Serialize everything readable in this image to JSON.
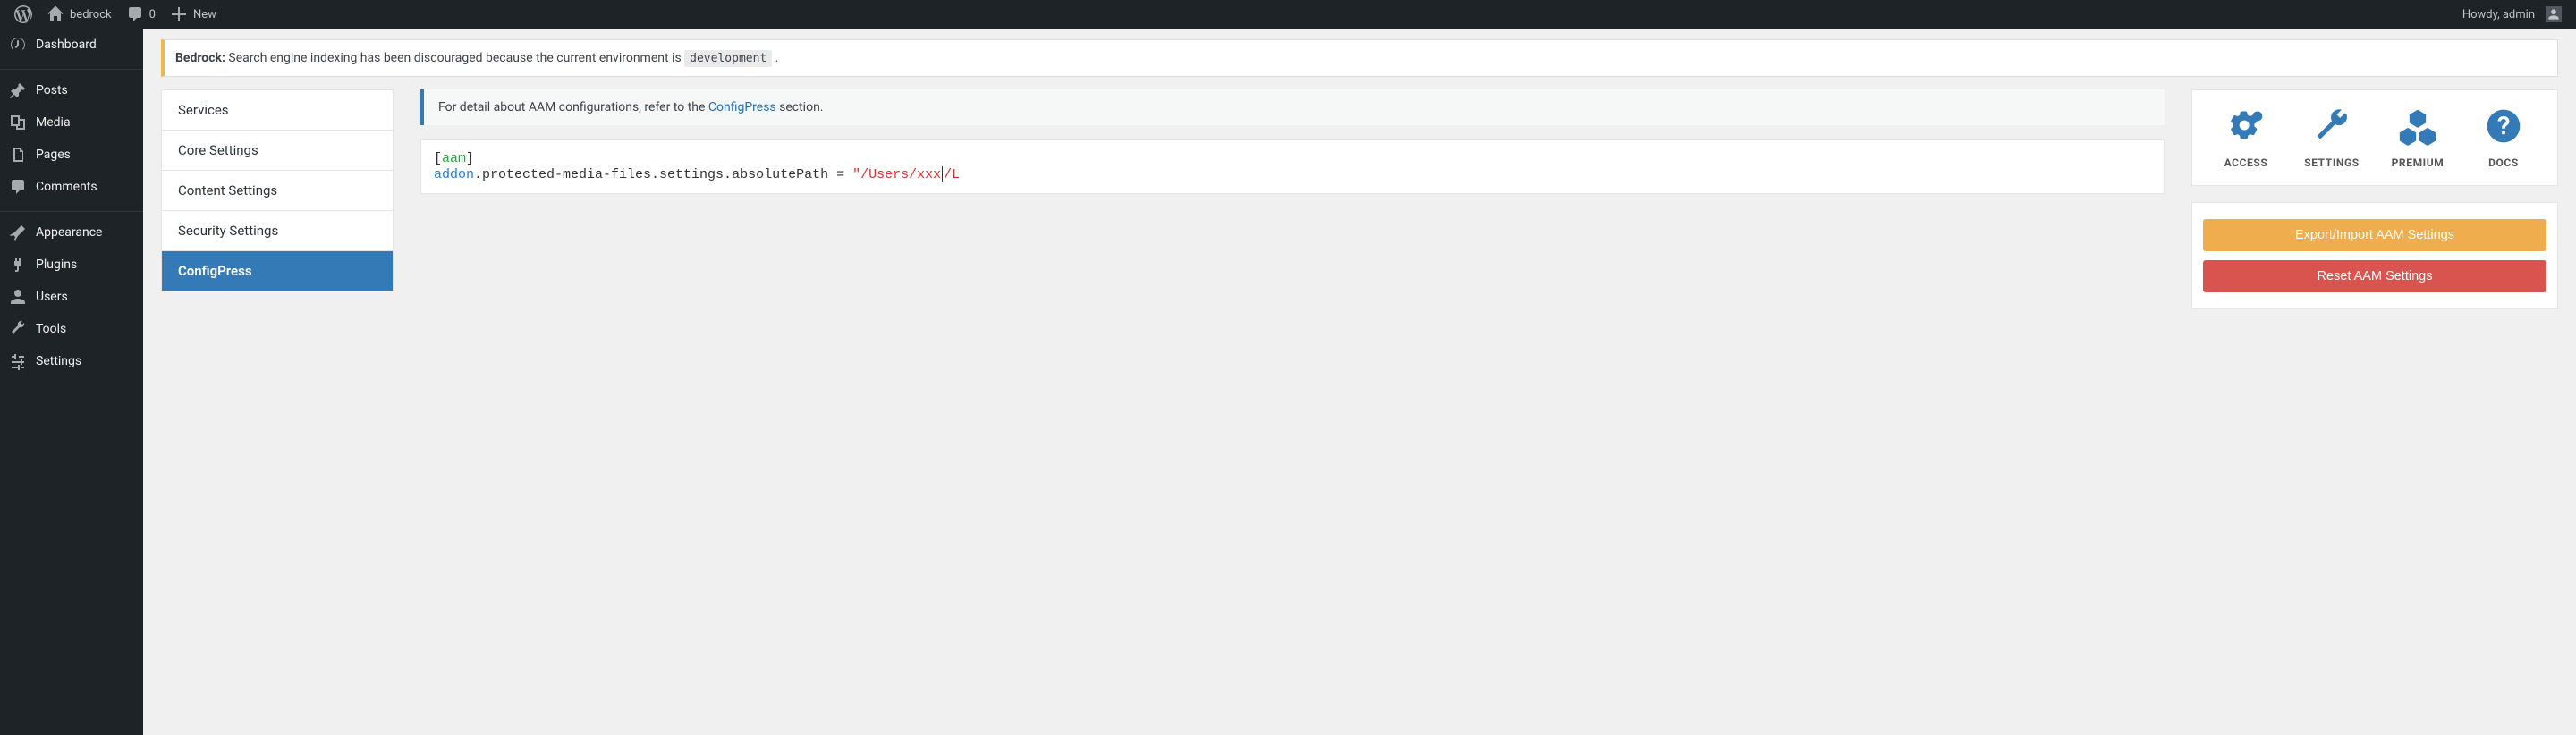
{
  "adminbar": {
    "site_name": "bedrock",
    "comments_count": "0",
    "new_label": "New",
    "howdy": "Howdy, admin"
  },
  "menu": {
    "dashboard": "Dashboard",
    "posts": "Posts",
    "media": "Media",
    "pages": "Pages",
    "comments": "Comments",
    "appearance": "Appearance",
    "plugins": "Plugins",
    "users": "Users",
    "tools": "Tools",
    "settings": "Settings"
  },
  "notice": {
    "prefix": "Bedrock:",
    "body": " Search engine indexing has been discouraged because the current environment is ",
    "env": "development",
    "suffix": " ."
  },
  "tabs": {
    "services": "Services",
    "core": "Core Settings",
    "content": "Content Settings",
    "security": "Security Settings",
    "configpress": "ConfigPress"
  },
  "info": {
    "text": "For detail about AAM configurations, refer to the ",
    "link": "ConfigPress",
    "suffix": " section."
  },
  "editor": {
    "section_open": "[",
    "section_name": "aam",
    "section_close": "]",
    "key": "addon",
    "rest": ".protected-media-files.settings.absolutePath = ",
    "quote": "\"",
    "str1": "/Users/xxx",
    "str2": "/L"
  },
  "iconbar": {
    "access": "ACCESS",
    "settings": "SETTINGS",
    "premium": "PREMIUM",
    "docs": "DOCS"
  },
  "buttons": {
    "export": "Export/Import AAM Settings",
    "reset": "Reset AAM Settings"
  }
}
